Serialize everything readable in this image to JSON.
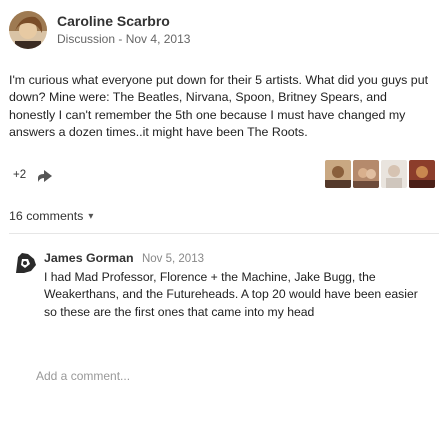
{
  "post": {
    "author": "Caroline Scarbro",
    "context": "Discussion",
    "separator": "-",
    "date": "Nov 4, 2013",
    "body": "I'm curious what everyone put down for their 5 artists.  What did you guys put down?  Mine were: The Beatles, Nirvana, Spoon, Britney Spears, and honestly I can't remember the 5th one because I must have changed my answers a dozen times..it might have been The Roots."
  },
  "actions": {
    "plus_count": "+2",
    "share_icon": "share-arrow-icon"
  },
  "comments_toggle": {
    "label": "16 comments"
  },
  "comment": {
    "author": "James Gorman",
    "date": "Nov 5, 2013",
    "body": "I had Mad Professor, Florence + the Machine, Jake Bugg, the Weakerthans, and the Futureheads. A top 20 would have been easier so these are the first ones that came into my head"
  },
  "add_comment": {
    "placeholder": "Add a comment..."
  },
  "colors": {
    "avatar_main": "#8c6a43",
    "text": "#222222",
    "muted": "#666666"
  }
}
